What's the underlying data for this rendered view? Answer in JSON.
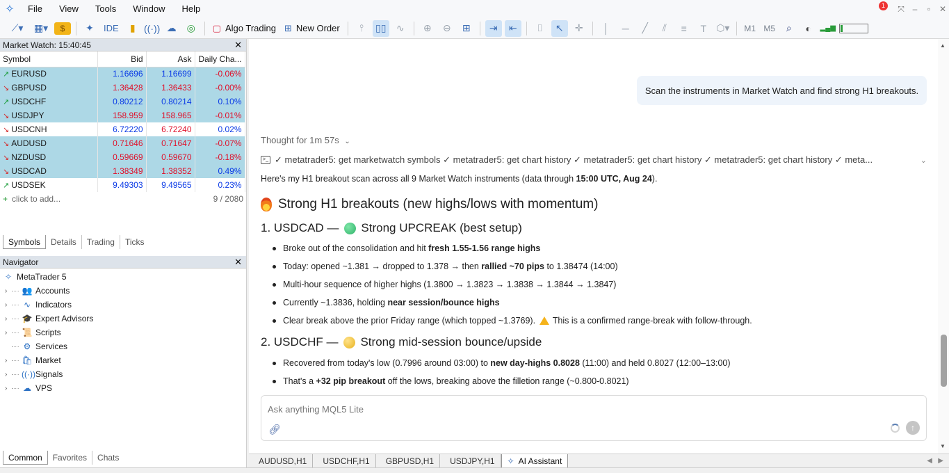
{
  "menu": [
    "File",
    "View",
    "Tools",
    "Window",
    "Help"
  ],
  "toolbar": {
    "ide": "IDE",
    "algo_trading": "Algo Trading",
    "new_order": "New Order",
    "m1": "M1",
    "m5": "M5",
    "notification_count": "1",
    "icons": [
      "line-chart-icon",
      "chart-template-icon",
      "dollar-icon",
      "metaeditor-icon",
      "ide-icon",
      "market-bag-icon",
      "signal-icon",
      "cloud-icon",
      "globe-icon",
      "algo-trading-icon",
      "new-order-icon",
      "bar-chart-icon",
      "candlestick-icon",
      "line-icon",
      "zoom-in-icon",
      "zoom-out-icon",
      "tile-windows-icon",
      "scroll-end-icon",
      "shift-chart-icon",
      "screenshot-icon",
      "cursor-icon",
      "crosshair-icon",
      "vertical-line-icon",
      "horizontal-line-icon",
      "trend-line-icon",
      "equidistant-channel-icon",
      "fibonacci-icon",
      "text-icon",
      "shapes-icon",
      "search-icon",
      "notifications-icon",
      "signal-strength-icon"
    ]
  },
  "market_watch": {
    "title": "Market Watch: 15:40:45",
    "columns": [
      "Symbol",
      "Bid",
      "Ask",
      "Daily Cha..."
    ],
    "rows": [
      {
        "symbol": "EURUSD",
        "bid": "1.16696",
        "ask": "1.16699",
        "change": "-0.06%",
        "dir": "up",
        "hl": true,
        "bid_dir": "up",
        "ask_dir": "up"
      },
      {
        "symbol": "GBPUSD",
        "bid": "1.36428",
        "ask": "1.36433",
        "change": "-0.00%",
        "dir": "down",
        "hl": true,
        "bid_dir": "dn",
        "ask_dir": "dn"
      },
      {
        "symbol": "USDCHF",
        "bid": "0.80212",
        "ask": "0.80214",
        "change": "0.10%",
        "dir": "up",
        "hl": true,
        "bid_dir": "up",
        "ask_dir": "up"
      },
      {
        "symbol": "USDJPY",
        "bid": "158.959",
        "ask": "158.965",
        "change": "-0.01%",
        "dir": "down",
        "hl": true,
        "bid_dir": "dn",
        "ask_dir": "dn"
      },
      {
        "symbol": "USDCNH",
        "bid": "6.72220",
        "ask": "6.72240",
        "change": "0.02%",
        "dir": "down",
        "hl": false,
        "bid_dir": "up",
        "ask_dir": "dn"
      },
      {
        "symbol": "AUDUSD",
        "bid": "0.71646",
        "ask": "0.71647",
        "change": "-0.07%",
        "dir": "down",
        "hl": true,
        "bid_dir": "dn",
        "ask_dir": "dn"
      },
      {
        "symbol": "NZDUSD",
        "bid": "0.59669",
        "ask": "0.59670",
        "change": "-0.18%",
        "dir": "down",
        "hl": true,
        "bid_dir": "dn",
        "ask_dir": "dn"
      },
      {
        "symbol": "USDCAD",
        "bid": "1.38349",
        "ask": "1.38352",
        "change": "0.49%",
        "dir": "down",
        "hl": true,
        "bid_dir": "dn",
        "ask_dir": "dn"
      },
      {
        "symbol": "USDSEK",
        "bid": "9.49303",
        "ask": "9.49565",
        "change": "0.23%",
        "dir": "up",
        "hl": false,
        "bid_dir": "up",
        "ask_dir": "up"
      }
    ],
    "add_label": "click to add...",
    "count": "9 / 2080",
    "tabs": [
      "Symbols",
      "Details",
      "Trading",
      "Ticks"
    ]
  },
  "navigator": {
    "title": "Navigator",
    "root": "MetaTrader 5",
    "items": [
      {
        "label": "Accounts",
        "icon": "accounts-icon",
        "glyph": "👥"
      },
      {
        "label": "Indicators",
        "icon": "indicators-icon",
        "glyph": "∿"
      },
      {
        "label": "Expert Advisors",
        "icon": "expert-advisors-icon",
        "glyph": "🎓"
      },
      {
        "label": "Scripts",
        "icon": "scripts-icon",
        "glyph": "📜"
      },
      {
        "label": "Services",
        "icon": "services-icon",
        "glyph": "⚙"
      },
      {
        "label": "Market",
        "icon": "market-icon",
        "glyph": "🛍"
      },
      {
        "label": "Signals",
        "icon": "signals-icon",
        "glyph": "((·))"
      },
      {
        "label": "VPS",
        "icon": "vps-icon",
        "glyph": "☁"
      }
    ],
    "tabs": [
      "Common",
      "Favorites",
      "Chats"
    ]
  },
  "chat": {
    "user_message": "Scan the instruments in Market Watch and find strong H1 breakouts.",
    "thought": "Thought for 1m 57s",
    "tools_line": "✓ metatrader5: get marketwatch symbols ✓ metatrader5: get chart history ✓ metatrader5: get chart history ✓ metatrader5: get chart history ✓ meta...",
    "intro_pre": "Here's my H1 breakout scan across all 9 Market Watch instruments (data through ",
    "intro_bold": "15:00 UTC, Aug 24",
    "intro_post": ").",
    "heading": "Strong H1 breakouts (new highs/lows with momentum)",
    "s1_title": "1. USDCAD — ",
    "s1_tag": "Strong UPCREAK (best setup)",
    "s1_b1_pre": "Broke out of the consolidation and hit ",
    "s1_b1_bold": "fresh 1.55-1.56 range highs",
    "s1_b2_pre": "Today: opened ~1.381 → dropped to 1.378 → then ",
    "s1_b2_bold": "rallied ~70 pips",
    "s1_b2_post": " to 1.38474 (14:00)",
    "s1_b3": "Multi-hour sequence of higher highs (1.3800 → 1.3823 → 1.3838 → 1.3844 → 1.3847)",
    "s1_b4_pre": "Currently ~1.3836, holding ",
    "s1_b4_bold": "near session/bounce highs",
    "s1_b5_pre": "Clear break above the prior Friday range (which topped ~1.3769). ",
    "s1_b5_post": " This is a confirmed range-break with follow-through.",
    "s2_title": "2. USDCHF — ",
    "s2_tag": "Strong mid-session bounce/upside",
    "s2_b1_pre": "Recovered from today's low (0.7996 around 03:00) to ",
    "s2_b1_bold": "new day-highs 0.8028",
    "s2_b1_post": " (11:00) and held 0.8027 (12:00–13:00)",
    "s2_b2_pre": "That's a ",
    "s2_b2_bold": "+32 pip breakout",
    "s2_b2_post": " off the lows, breaking above the filletion range (~0.800-0.8021)",
    "input_placeholder": "Ask anything MQL5 Lite"
  },
  "chart_tabs": [
    "AUDUSD,H1",
    "USDCHF,H1",
    "GBPUSD,H1",
    "USDJPY,H1",
    "AI Assistant"
  ],
  "colors": {
    "green_dot": "#3cc47c",
    "yellow_dot": "#f2c230",
    "highlight": "#add8e6"
  }
}
